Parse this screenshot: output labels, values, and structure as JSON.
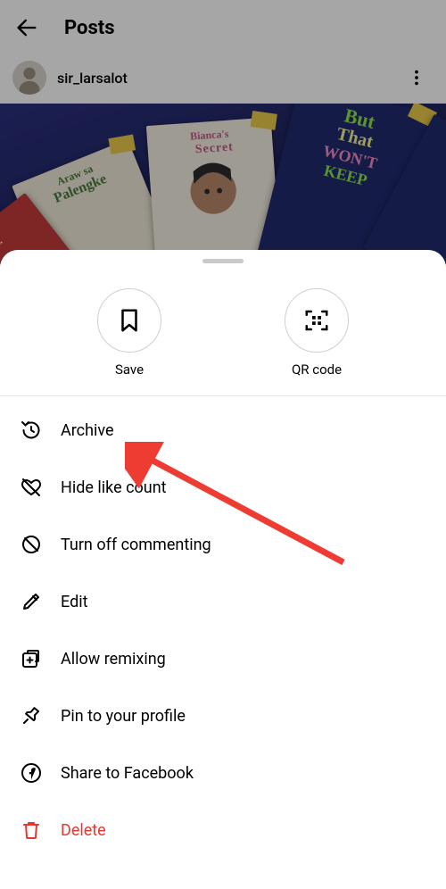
{
  "header": {
    "title": "Posts"
  },
  "post": {
    "username": "sir_larsalot"
  },
  "sheet": {
    "actions": {
      "save": "Save",
      "qr": "QR code"
    },
    "menu": {
      "archive": "Archive",
      "hide_likes": "Hide like count",
      "turn_off_commenting": "Turn off commenting",
      "edit": "Edit",
      "allow_remixing": "Allow remixing",
      "pin": "Pin to your profile",
      "share_fb": "Share to Facebook",
      "delete": "Delete"
    }
  },
  "colors": {
    "danger": "#e9362f"
  }
}
